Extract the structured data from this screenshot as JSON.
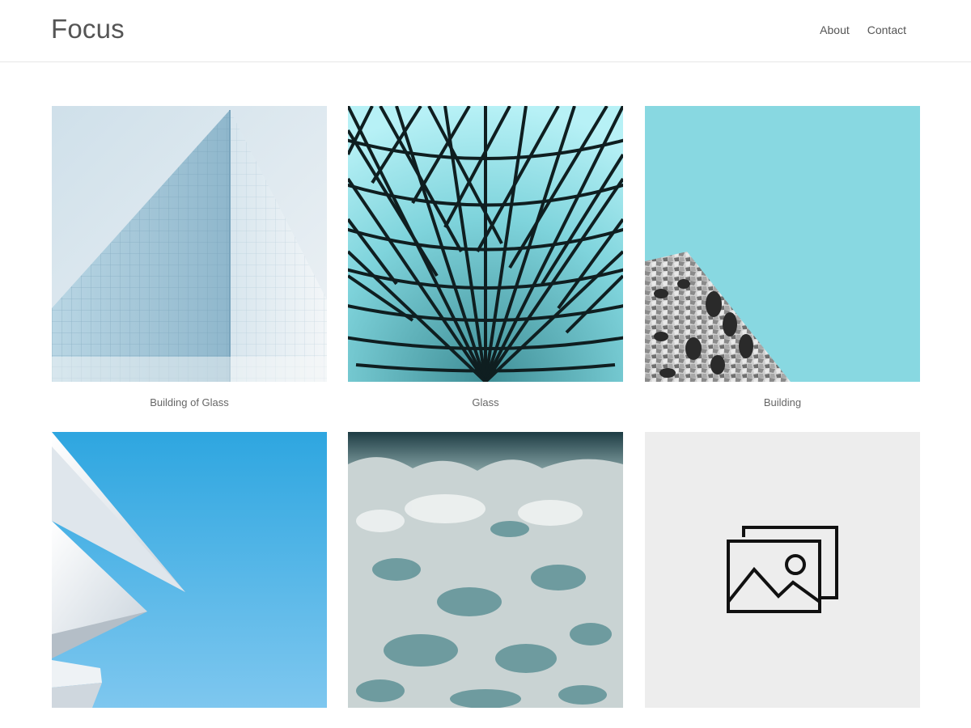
{
  "site": {
    "title": "Focus"
  },
  "nav": {
    "items": [
      {
        "label": "About"
      },
      {
        "label": "Contact"
      }
    ]
  },
  "gallery": {
    "items": [
      {
        "caption": "Building of Glass",
        "image": "glass-facade-building"
      },
      {
        "caption": "Glass",
        "image": "geodesic-glass-roof"
      },
      {
        "caption": "Building",
        "image": "mosaic-building-corner"
      },
      {
        "caption": "",
        "image": "white-roof-blue-sky"
      },
      {
        "caption": "",
        "image": "sea-foam-aerial"
      },
      {
        "caption": "",
        "image": "image-placeholder-icon"
      }
    ]
  },
  "colors": {
    "placeholder_bg": "#ededed",
    "sky_teal": "#88d8e1",
    "sky_blue": "#3aaee2"
  }
}
